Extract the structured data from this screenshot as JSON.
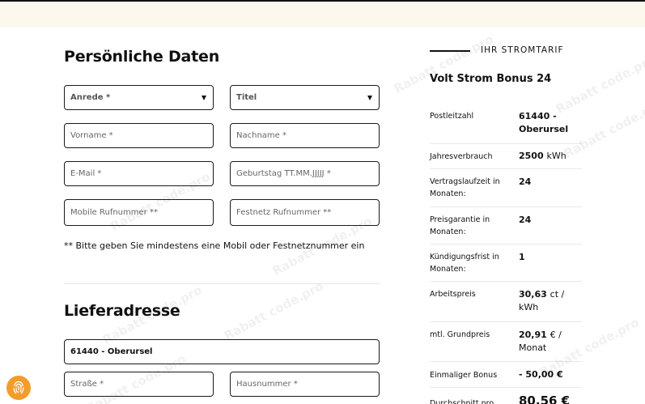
{
  "sections": {
    "personal_title": "Persönliche Daten",
    "delivery_title": "Lieferadresse"
  },
  "personal": {
    "anrede": "Anrede *",
    "titel": "Titel",
    "vorname": "Vorname *",
    "nachname": "Nachname *",
    "email": "E-Mail *",
    "geburtstag": "Geburtstag TT.MM.JJJJJ *",
    "mobile": "Mobile Rufnummer **",
    "festnetz": "Festnetz Rufnummer **",
    "hint": "** Bitte geben Sie mindestens eine Mobil oder Festnetznummer ein"
  },
  "delivery": {
    "plz_city": "61440 - Oberursel",
    "strasse": "Straße *",
    "hausnummer": "Hausnummer *"
  },
  "tariff": {
    "label": "IHR STROMTARIF",
    "name": "Volt Strom Bonus 24",
    "rows": [
      {
        "key": "Postleitzahl",
        "value": "61440 - Oberursel",
        "unit": ""
      },
      {
        "key": "Jahresverbrauch",
        "value": "2500",
        "unit": "kWh"
      },
      {
        "key": "Vertragslaufzeit in Monaten:",
        "value": "24",
        "unit": ""
      },
      {
        "key": "Preisgarantie in Monaten:",
        "value": "24",
        "unit": ""
      },
      {
        "key": "Kündigungsfrist in Monaten:",
        "value": "1",
        "unit": ""
      },
      {
        "key": "Arbeitspreis",
        "value": "30,63",
        "unit": "ct / kWh"
      },
      {
        "key": "mtl. Grundpreis",
        "value": "20,91",
        "unit": "€ / Monat"
      },
      {
        "key": "Einmaliger Bonus",
        "value": "- 50,00 €",
        "unit": ""
      },
      {
        "key": "Durchschnitt pro",
        "value": "80,56 €",
        "unit": ""
      }
    ]
  },
  "watermark": "Rabatt code.pro",
  "icons": {
    "fingerprint": "fingerprint-icon",
    "dropdown": "caret-down-icon"
  },
  "colors": {
    "accent": "#f39c2a",
    "topbar": "#fdf8ee"
  }
}
